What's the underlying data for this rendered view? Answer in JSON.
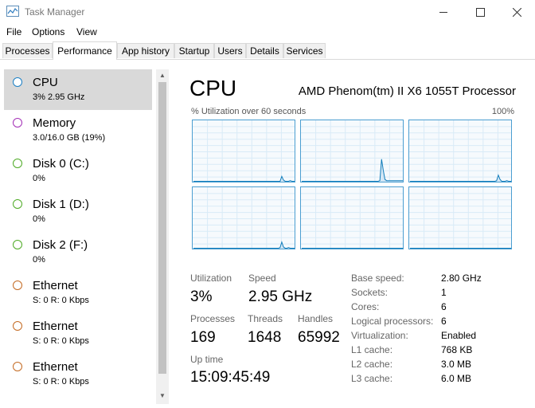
{
  "window": {
    "title": "Task Manager"
  },
  "menu": [
    "File",
    "Options",
    "View"
  ],
  "tabs": [
    "Processes",
    "Performance",
    "App history",
    "Startup",
    "Users",
    "Details",
    "Services"
  ],
  "sidebar": {
    "items": [
      {
        "title": "CPU",
        "sub": "3%  2.95 GHz",
        "color": "#1b7fc4"
      },
      {
        "title": "Memory",
        "sub": "3.0/16.0 GB (19%)",
        "color": "#a32fb6"
      },
      {
        "title": "Disk 0 (C:)",
        "sub": "0%",
        "color": "#4daa24"
      },
      {
        "title": "Disk 1 (D:)",
        "sub": "0%",
        "color": "#4daa24"
      },
      {
        "title": "Disk 2 (F:)",
        "sub": "0%",
        "color": "#4daa24"
      },
      {
        "title": "Ethernet",
        "sub": "S: 0  R: 0 Kbps",
        "color": "#c46a22"
      },
      {
        "title": "Ethernet",
        "sub": "S: 0  R: 0 Kbps",
        "color": "#c46a22"
      },
      {
        "title": "Ethernet",
        "sub": "S: 0  R: 0 Kbps",
        "color": "#c46a22"
      }
    ]
  },
  "main": {
    "title": "CPU",
    "processor": "AMD Phenom(tm) II X6 1055T Processor",
    "graph_label": "% Utilization over 60 seconds",
    "graph_max": "100%",
    "stats": {
      "utilization_label": "Utilization",
      "utilization": "3%",
      "speed_label": "Speed",
      "speed": "2.95 GHz",
      "processes_label": "Processes",
      "processes": "169",
      "threads_label": "Threads",
      "threads": "1648",
      "handles_label": "Handles",
      "handles": "65992",
      "uptime_label": "Up time",
      "uptime": "15:09:45:49"
    },
    "specs": [
      {
        "label": "Base speed:",
        "value": "2.80 GHz"
      },
      {
        "label": "Sockets:",
        "value": "1"
      },
      {
        "label": "Cores:",
        "value": "6"
      },
      {
        "label": "Logical processors:",
        "value": "6"
      },
      {
        "label": "Virtualization:",
        "value": "Enabled"
      },
      {
        "label": "L1 cache:",
        "value": "768 KB"
      },
      {
        "label": "L2 cache:",
        "value": "3.0 MB"
      },
      {
        "label": "L3 cache:",
        "value": "6.0 MB"
      }
    ]
  },
  "chart_data": {
    "type": "line",
    "ylim": [
      0,
      100
    ],
    "series": [
      {
        "values": [
          2,
          2,
          2,
          2,
          2,
          2,
          2,
          2,
          2,
          2,
          2,
          2,
          2,
          2,
          2,
          2,
          2,
          2,
          2,
          2,
          2,
          2,
          2,
          2,
          2,
          2,
          2,
          2,
          2,
          2,
          2,
          2,
          2,
          2,
          2,
          2,
          2,
          2,
          2,
          2,
          2,
          2,
          2,
          2,
          2,
          2,
          2,
          2,
          2,
          2,
          2,
          2,
          10,
          4,
          2,
          2,
          2,
          3,
          2,
          2,
          2
        ]
      },
      {
        "values": [
          2,
          2,
          2,
          2,
          2,
          2,
          2,
          2,
          2,
          2,
          2,
          2,
          2,
          2,
          2,
          2,
          2,
          2,
          2,
          2,
          2,
          2,
          2,
          2,
          2,
          2,
          2,
          2,
          2,
          2,
          2,
          2,
          2,
          2,
          2,
          2,
          2,
          2,
          2,
          2,
          2,
          2,
          2,
          2,
          2,
          2,
          3,
          38,
          20,
          5,
          3,
          3,
          3,
          3,
          3,
          3,
          3,
          3,
          3,
          3,
          3
        ]
      },
      {
        "values": [
          2,
          2,
          2,
          2,
          2,
          2,
          2,
          2,
          2,
          2,
          2,
          2,
          2,
          2,
          2,
          2,
          2,
          2,
          2,
          2,
          2,
          2,
          2,
          2,
          2,
          2,
          2,
          2,
          2,
          2,
          2,
          2,
          2,
          2,
          2,
          2,
          2,
          2,
          2,
          2,
          2,
          2,
          2,
          2,
          2,
          2,
          2,
          2,
          2,
          2,
          2,
          3,
          12,
          5,
          2,
          2,
          2,
          3,
          2,
          2,
          2
        ]
      },
      {
        "values": [
          2,
          2,
          2,
          2,
          2,
          2,
          2,
          2,
          2,
          2,
          2,
          2,
          2,
          2,
          2,
          2,
          2,
          2,
          2,
          2,
          2,
          2,
          2,
          2,
          2,
          2,
          2,
          2,
          2,
          2,
          2,
          2,
          2,
          2,
          2,
          2,
          2,
          2,
          2,
          2,
          2,
          2,
          2,
          2,
          2,
          2,
          2,
          2,
          2,
          2,
          2,
          3,
          12,
          4,
          2,
          2,
          3,
          2,
          2,
          2,
          2
        ]
      },
      {
        "values": [
          2,
          2,
          2,
          2,
          2,
          2,
          2,
          2,
          2,
          2,
          2,
          2,
          2,
          2,
          2,
          2,
          2,
          2,
          2,
          2,
          2,
          2,
          2,
          2,
          2,
          2,
          2,
          2,
          2,
          2,
          2,
          2,
          2,
          2,
          2,
          2,
          2,
          2,
          2,
          2,
          2,
          2,
          2,
          2,
          2,
          2,
          2,
          2,
          2,
          2,
          2,
          2,
          2,
          2,
          2,
          2,
          2,
          2,
          2,
          2,
          2
        ]
      },
      {
        "values": [
          2,
          2,
          2,
          2,
          2,
          2,
          2,
          2,
          2,
          2,
          2,
          2,
          2,
          2,
          2,
          2,
          2,
          2,
          2,
          2,
          2,
          2,
          2,
          2,
          2,
          2,
          2,
          2,
          2,
          2,
          2,
          2,
          2,
          2,
          2,
          2,
          2,
          2,
          2,
          2,
          2,
          2,
          2,
          2,
          2,
          2,
          2,
          2,
          2,
          2,
          2,
          2,
          2,
          2,
          2,
          2,
          2,
          2,
          2,
          2,
          2
        ]
      }
    ]
  }
}
